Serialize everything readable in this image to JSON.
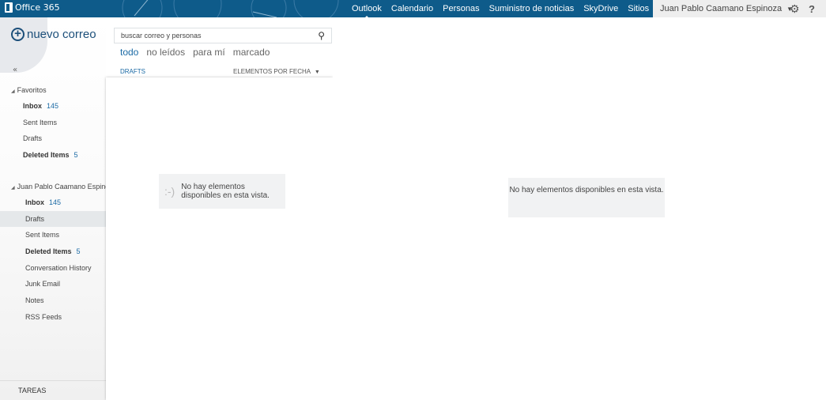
{
  "topbar": {
    "brand": "Office 365",
    "nav": [
      "Outlook",
      "Calendario",
      "Personas",
      "Suministro de noticias",
      "SkyDrive",
      "Sitios",
      "•••"
    ],
    "active": "Outlook",
    "user": "Juan Pablo Caamano Espinoza",
    "bg": "#0e5b8a"
  },
  "actions": {
    "new_mail": "nuevo correo",
    "collapse": "«"
  },
  "search": {
    "placeholder": "buscar correo y personas"
  },
  "filters": [
    "todo",
    "no leídos",
    "para mí",
    "marcado"
  ],
  "list": {
    "folder": "DRAFTS",
    "sort": "ELEMENTOS POR FECHA",
    "empty": "No hay elementos disponibles en esta vista.",
    "emoticon": ":-)"
  },
  "reading": {
    "empty": "No hay elementos disponibles en esta vista."
  },
  "favorites": {
    "label": "Favoritos",
    "items": [
      {
        "name": "Inbox",
        "count": "145",
        "bold": true
      },
      {
        "name": "Sent Items"
      },
      {
        "name": "Drafts"
      },
      {
        "name": "Deleted Items",
        "count": "5",
        "bold": true
      }
    ]
  },
  "mailbox": {
    "label": "Juan Pablo Caamano Espinoza",
    "items": [
      {
        "name": "Inbox",
        "count": "145",
        "bold": true
      },
      {
        "name": "Drafts",
        "selected": true
      },
      {
        "name": "Sent Items"
      },
      {
        "name": "Deleted Items",
        "count": "5",
        "bold": true
      },
      {
        "name": "Conversation History"
      },
      {
        "name": "Junk Email"
      },
      {
        "name": "Notes"
      },
      {
        "name": "RSS Feeds"
      }
    ]
  },
  "footer": {
    "tasks": "TAREAS"
  }
}
